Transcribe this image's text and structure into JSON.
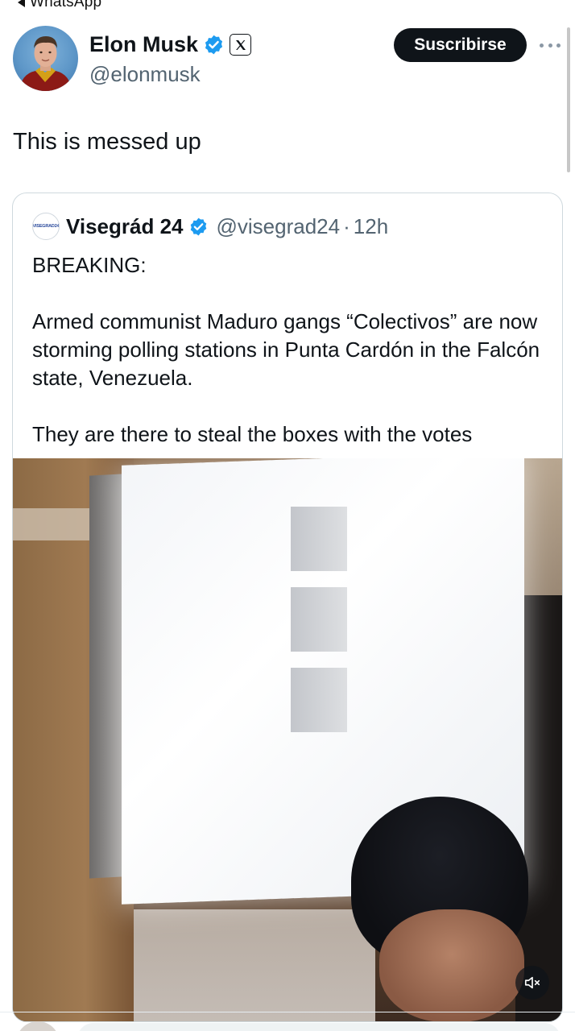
{
  "status_bar": {
    "back_label": "WhatsApp"
  },
  "tweet": {
    "author_name": "Elon Musk",
    "author_handle": "@elonmusk",
    "subscribe_label": "Suscribirse",
    "text": "This is messed up"
  },
  "quoted_tweet": {
    "avatar_text": "VISEGRAD24",
    "author_name": "Visegrád 24",
    "author_handle": "@visegrad24",
    "separator": "·",
    "time": "12h",
    "lines": {
      "l1": "BREAKING:",
      "l2": "Armed communist Maduro gangs “Colectivos” are now storming polling stations in Punta Cardón in the Falcón state, Venezuela.",
      "l3": "They are there to steal the boxes with the votes"
    },
    "flag_icon": "venezuela-flag-icon"
  },
  "icons": {
    "verified": "verified-badge-icon",
    "x_logo": "x-logo-icon",
    "more": "more-options-icon",
    "mute": "volume-muted-icon"
  },
  "colors": {
    "verified_blue": "#1d9bf0",
    "primary_text": "#0f1419",
    "secondary_text": "#536471",
    "border": "#cfd9de"
  }
}
